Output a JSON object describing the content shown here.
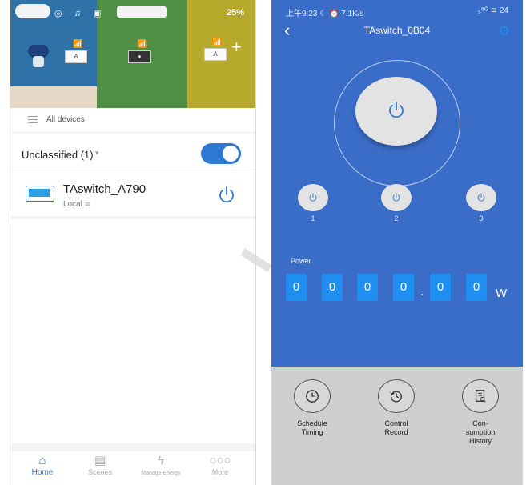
{
  "left_app": {
    "status_bar": {
      "icons_text": "◎ ♫ ▣",
      "right_text": "25%"
    },
    "all_devices_label": "All devices",
    "group": {
      "label": "Unclassified (1)",
      "caret": "▾",
      "toggle_on": true
    },
    "device": {
      "name": "TAswitch_A790",
      "status": "Local"
    },
    "tabs": [
      {
        "label": "Home",
        "icon": "home-icon",
        "active": true
      },
      {
        "label": "Scenes",
        "icon": "scenes-icon",
        "active": false
      },
      {
        "label": "Manage Energy",
        "icon": "energy-icon",
        "active": false
      },
      {
        "label": "More",
        "icon": "more-icon",
        "active": false
      }
    ]
  },
  "right_app": {
    "status_bar": {
      "left_text": "上午9:23 ☾ ⏰  7.1K/s",
      "right_text": "₅⁶ᴳ ≋ 24"
    },
    "title": "TAswitch_0B04",
    "channels": [
      "1",
      "2",
      "3"
    ],
    "power": {
      "label": "Power",
      "digits": [
        "0",
        "0",
        "0",
        "0",
        "0",
        "0"
      ],
      "decimal": ".",
      "unit": "W"
    },
    "functions": [
      {
        "label": "Schedule\nTiming",
        "icon": "clock-icon"
      },
      {
        "label": "Control\nRecord",
        "icon": "history-icon"
      },
      {
        "label": "Con-\nsumption\nHistory",
        "icon": "report-icon"
      }
    ]
  },
  "colors": {
    "accent_blue": "#2f78d2",
    "panel_blue": "#3a6dc8",
    "digit_blue": "#1e8ef0",
    "function_bg": "#cfcfcf"
  }
}
